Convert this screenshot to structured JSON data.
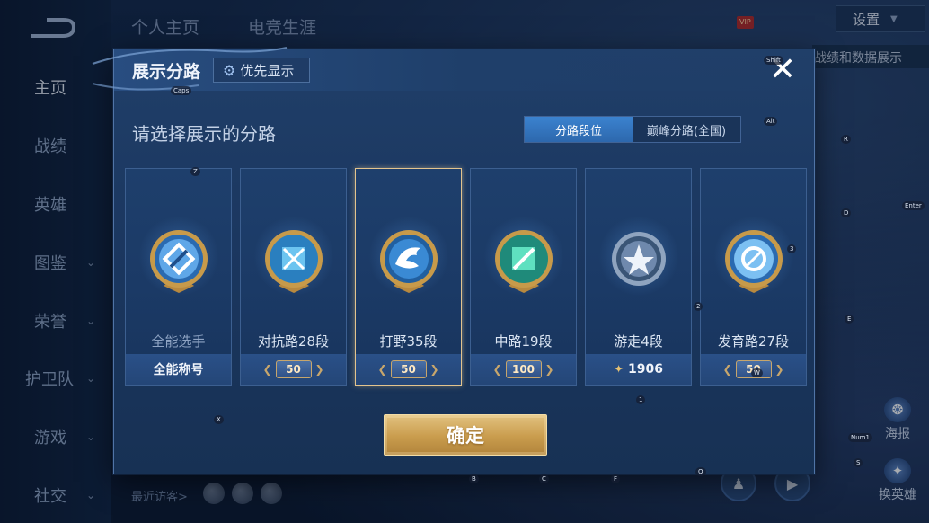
{
  "background": {
    "top_tabs": [
      "个人主页",
      "电竞生涯"
    ],
    "nav": [
      {
        "label": "主页",
        "chevron": false,
        "active": true
      },
      {
        "label": "战绩",
        "chevron": false,
        "active": false
      },
      {
        "label": "英雄",
        "chevron": false,
        "active": false
      },
      {
        "label": "图鉴",
        "chevron": true,
        "active": false
      },
      {
        "label": "荣誉",
        "chevron": true,
        "active": false
      },
      {
        "label": "护卫队",
        "chevron": true,
        "active": false
      },
      {
        "label": "游戏",
        "chevron": true,
        "active": false
      },
      {
        "label": "社交",
        "chevron": true,
        "active": false
      }
    ],
    "settings_label": "设置",
    "vip_badge": "VIP",
    "right_label": "战绩和数据展示",
    "recent_visitors": "最近访客>",
    "side_buttons": [
      {
        "label": "海报",
        "icon": "poster-icon"
      },
      {
        "label": "换英雄",
        "icon": "swap-hero-icon"
      }
    ],
    "key_hints": [
      "Caps",
      "Z",
      "Shift",
      "Alt",
      "R",
      "D",
      "Enter",
      "E",
      "3",
      "2",
      "1",
      "X",
      "B",
      "C",
      "F",
      "Q",
      "Num1",
      "S",
      "W"
    ]
  },
  "modal": {
    "title": "展示分路",
    "priority_button": "优先显示",
    "close_label": "✕",
    "subtitle": "请选择展示的分路",
    "segments": [
      {
        "label": "分路段位",
        "active": true
      },
      {
        "label": "巅峰分路(全国)",
        "active": false
      }
    ],
    "cards": [
      {
        "name": "全能选手",
        "footer": "全能称号",
        "footer_type": "text",
        "selected": false,
        "emblem": "allround-emblem-icon",
        "dim": true
      },
      {
        "name": "对抗路28段",
        "footer": "50",
        "footer_type": "badge",
        "selected": false,
        "emblem": "clash-lane-emblem-icon",
        "dim": false
      },
      {
        "name": "打野35段",
        "footer": "50",
        "footer_type": "badge",
        "selected": true,
        "emblem": "jungle-emblem-icon",
        "dim": false
      },
      {
        "name": "中路19段",
        "footer": "100",
        "footer_type": "badge",
        "selected": false,
        "emblem": "mid-lane-emblem-icon",
        "dim": false
      },
      {
        "name": "游走4段",
        "footer": "1906",
        "footer_type": "points",
        "selected": false,
        "emblem": "roam-emblem-icon",
        "dim": false
      },
      {
        "name": "发育路27段",
        "footer": "50",
        "footer_type": "badge",
        "selected": false,
        "emblem": "farm-lane-emblem-icon",
        "dim": false
      }
    ],
    "confirm_label": "确定"
  },
  "colors": {
    "modal_bg": "#1b3760",
    "accent_blue": "#3b82cf",
    "gold": "#c99c4d",
    "selected_border": "#e3c48e"
  }
}
